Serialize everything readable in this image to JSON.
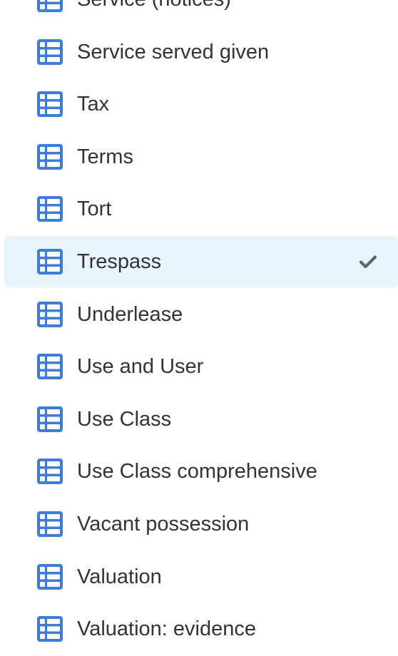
{
  "colors": {
    "icon_blue": "#3b7dd8",
    "selected_bg": "#e8f4fc",
    "text": "#333333",
    "check": "#666666"
  },
  "list": {
    "items": [
      {
        "label": "Service (notices)",
        "icon": "table-icon",
        "selected": false
      },
      {
        "label": "Service served given",
        "icon": "table-icon",
        "selected": false
      },
      {
        "label": "Tax",
        "icon": "table-icon",
        "selected": false
      },
      {
        "label": "Terms",
        "icon": "table-icon",
        "selected": false
      },
      {
        "label": "Tort",
        "icon": "table-icon",
        "selected": false
      },
      {
        "label": "Trespass",
        "icon": "table-icon",
        "selected": true
      },
      {
        "label": "Underlease",
        "icon": "table-icon",
        "selected": false
      },
      {
        "label": "Use and User",
        "icon": "table-icon",
        "selected": false
      },
      {
        "label": "Use Class",
        "icon": "table-icon",
        "selected": false
      },
      {
        "label": "Use Class comprehensive",
        "icon": "table-icon",
        "selected": false
      },
      {
        "label": "Vacant possession",
        "icon": "table-icon",
        "selected": false
      },
      {
        "label": "Valuation",
        "icon": "table-icon",
        "selected": false
      },
      {
        "label": "Valuation: evidence",
        "icon": "table-icon",
        "selected": false
      }
    ]
  }
}
